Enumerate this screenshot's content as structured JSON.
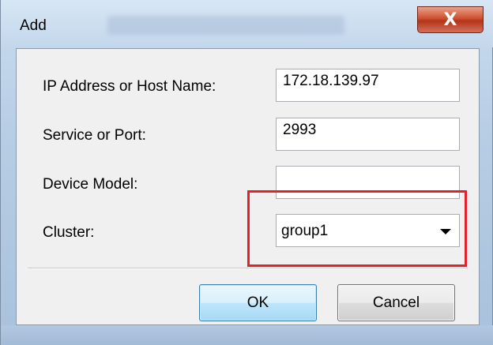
{
  "window": {
    "title": "Add",
    "close_glyph": "X"
  },
  "form": {
    "ip_label": "IP Address or Host Name:",
    "ip_value": "172.18.139.97",
    "port_label": "Service or Port:",
    "port_value": "2993",
    "model_label": "Device Model:",
    "model_value": "",
    "cluster_label": "Cluster:",
    "cluster_value": "group1"
  },
  "buttons": {
    "ok": "OK",
    "cancel": "Cancel"
  },
  "colors": {
    "highlight": "#e4202b",
    "ok_border": "#3c7fb1"
  }
}
